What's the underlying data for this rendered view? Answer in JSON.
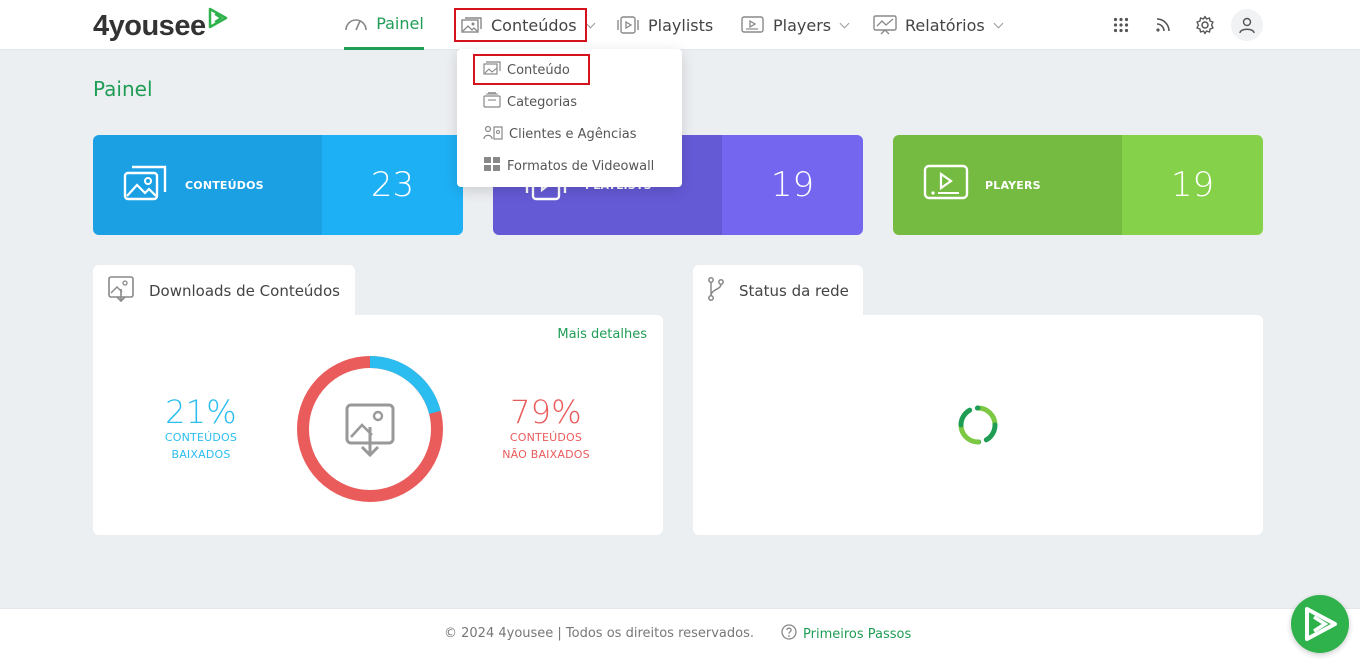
{
  "brand": {
    "name": "4yousee"
  },
  "nav": {
    "items": [
      {
        "label": "Painel",
        "icon": "gauge-icon",
        "active": true
      },
      {
        "label": "Conteúdos",
        "icon": "image-icon",
        "has_dropdown": true
      },
      {
        "label": "Playlists",
        "icon": "playlist-icon"
      },
      {
        "label": "Players",
        "icon": "player-icon",
        "has_dropdown": true
      },
      {
        "label": "Relatórios",
        "icon": "report-icon",
        "has_dropdown": true
      }
    ]
  },
  "top_icons": [
    "apps-grid-icon",
    "rss-icon",
    "gear-icon",
    "user-icon"
  ],
  "dropdown": {
    "items": [
      {
        "label": "Conteúdo",
        "icon": "image-icon"
      },
      {
        "label": "Categorias",
        "icon": "categories-icon"
      },
      {
        "label": "Clientes e Agências",
        "icon": "clients-icon"
      },
      {
        "label": "Formatos de Videowall",
        "icon": "videowall-icon"
      }
    ]
  },
  "page": {
    "title": "Painel"
  },
  "stats": [
    {
      "label": "CONTEÚDOS",
      "value": "23",
      "color_left": "#1ba0e4",
      "color_right": "#1eb0f5",
      "icon": "image-icon"
    },
    {
      "label": "PLAYLISTS",
      "value": "19",
      "color_left": "#655ad6",
      "color_right": "#7466ef",
      "icon": "playlist-icon"
    },
    {
      "label": "PLAYERS",
      "value": "19",
      "color_left": "#76bb41",
      "color_right": "#86d14a",
      "icon": "player-icon"
    }
  ],
  "downloads": {
    "title": "Downloads de Conteúdos",
    "more_link": "Mais detalhes",
    "downloaded": {
      "percent": "21%",
      "line1": "CONTEÚDOS",
      "line2": "BAIXADOS",
      "fraction": 0.21,
      "color": "#2bbdf0"
    },
    "not_downloaded": {
      "percent": "79%",
      "line1": "CONTEÚDOS",
      "line2": "NÃO BAIXADOS",
      "fraction": 0.79,
      "color": "#ea5b5b"
    }
  },
  "network": {
    "title": "Status da rede"
  },
  "footer": {
    "copyright": "© 2024 4yousee | Todos os direitos reservados.",
    "help_link": "Primeiros Passos"
  }
}
